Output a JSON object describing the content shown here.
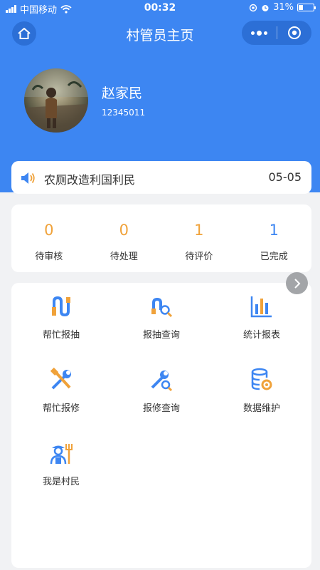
{
  "status_bar": {
    "carrier": "中国移动",
    "time": "00:32",
    "battery": "31%"
  },
  "nav": {
    "title": "村管员主页"
  },
  "user": {
    "name": "赵家民",
    "id": "12345011"
  },
  "notice": {
    "text": "农厕改造利国利民",
    "date": "05-05"
  },
  "stats": [
    {
      "value": "0",
      "label": "待审核",
      "color": "#f0a23a"
    },
    {
      "value": "0",
      "label": "待处理",
      "color": "#f0a23a"
    },
    {
      "value": "1",
      "label": "待评价",
      "color": "#f0a23a"
    },
    {
      "value": "1",
      "label": "已完成",
      "color": "#3d86f2"
    }
  ],
  "menu": [
    {
      "label": "帮忙报抽",
      "icon": "pipe-icon"
    },
    {
      "label": "报抽查询",
      "icon": "pipe-search-icon"
    },
    {
      "label": "统计报表",
      "icon": "bar-chart-icon"
    },
    {
      "label": "帮忙报修",
      "icon": "repair-tools-icon"
    },
    {
      "label": "报修查询",
      "icon": "wrench-search-icon"
    },
    {
      "label": "数据维护",
      "icon": "database-gear-icon"
    },
    {
      "label": "我是村民",
      "icon": "farmer-icon"
    }
  ],
  "colors": {
    "primary": "#3d86f2",
    "accent": "#f0a23a"
  }
}
